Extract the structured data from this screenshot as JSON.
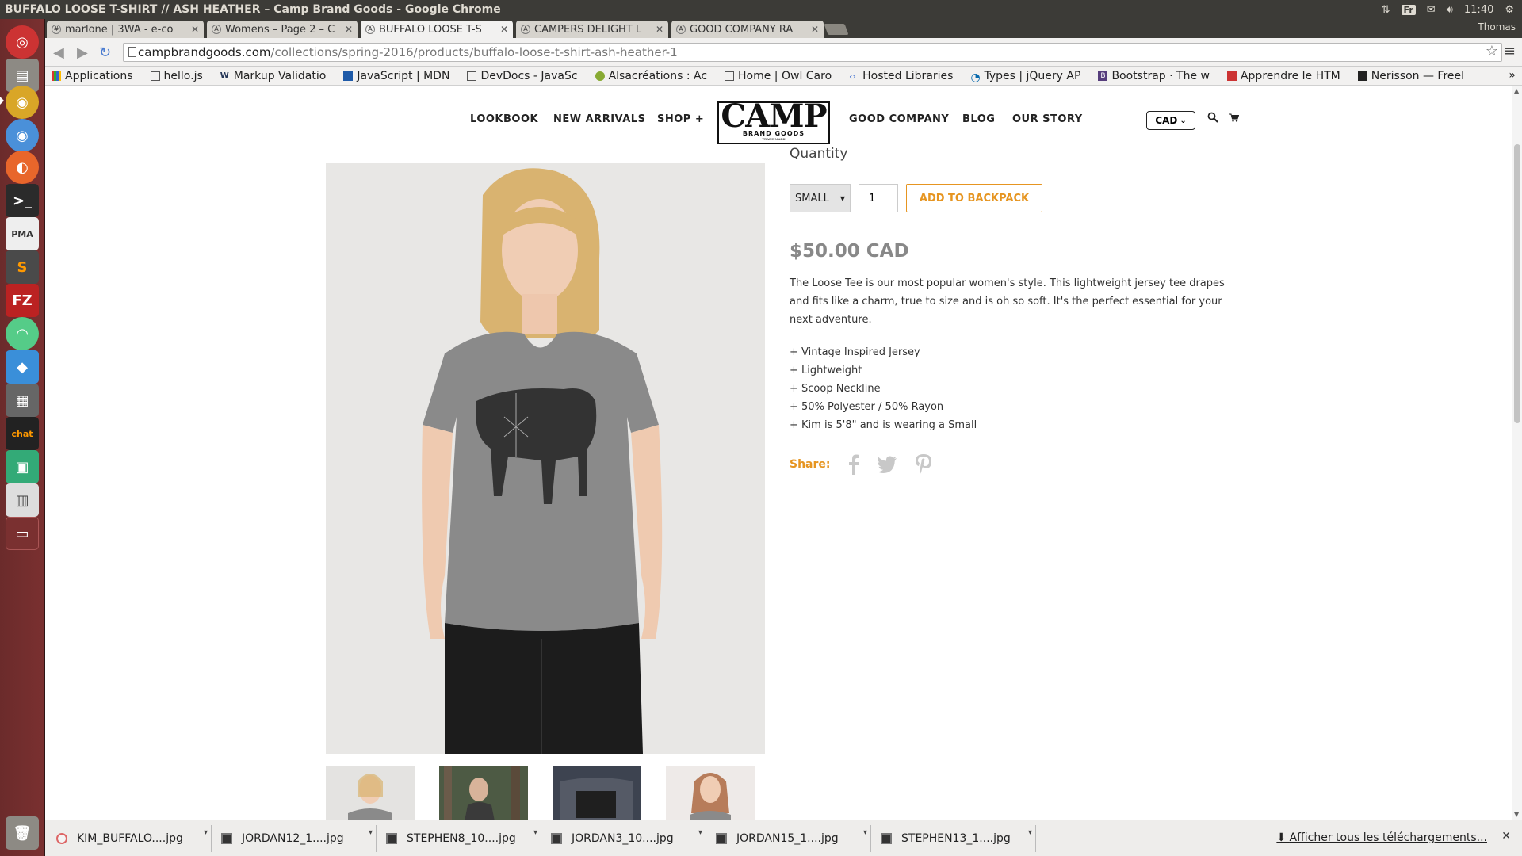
{
  "window": {
    "title": "BUFFALO LOOSE T-SHIRT // ASH HEATHER – Camp Brand Goods - Google Chrome",
    "keyboard_layout": "Fr",
    "time": "11:40",
    "user": "Thomas"
  },
  "tabs": [
    {
      "label": "marlone | 3WA - e-co"
    },
    {
      "label": "Womens – Page 2 – C"
    },
    {
      "label": "BUFFALO LOOSE T-S"
    },
    {
      "label": "CAMPERS DELIGHT L"
    },
    {
      "label": "GOOD COMPANY RA"
    }
  ],
  "address": {
    "domain": "campbrandgoods.com",
    "path": "/collections/spring-2016/products/buffalo-loose-t-shirt-ash-heather-1"
  },
  "bookmarks": [
    {
      "label": "Applications"
    },
    {
      "label": "hello.js"
    },
    {
      "label": "Markup Validatio"
    },
    {
      "label": "JavaScript | MDN"
    },
    {
      "label": "DevDocs - JavaSc"
    },
    {
      "label": "Alsacréations : Ac"
    },
    {
      "label": "Home | Owl Caro"
    },
    {
      "label": "Hosted Libraries"
    },
    {
      "label": "Types | jQuery AP"
    },
    {
      "label": "Bootstrap · The w"
    },
    {
      "label": "Apprendre le HTM"
    },
    {
      "label": "Nerisson — Freel"
    }
  ],
  "nav": {
    "lookbook": "LOOKBOOK",
    "new_arrivals": "NEW ARRIVALS",
    "shop": "SHOP +",
    "good_company": "GOOD COMPANY",
    "blog": "BLOG",
    "our_story": "OUR STORY",
    "currency": "CAD"
  },
  "logo": {
    "big": "CAMP",
    "small": "BRAND GOODS",
    "tm": "TRADE MARK"
  },
  "product": {
    "quantity_label": "Quantity",
    "size": "SMALL",
    "quantity": "1",
    "add_button": "ADD TO BACKPACK",
    "price": "$50.00 CAD",
    "description": "The Loose Tee is our most popular women's style. This lightweight jersey tee drapes and fits like a charm, true to size and is oh so soft. It's the perfect essential for your next adventure.",
    "features": [
      "+ Vintage Inspired Jersey",
      "+ Lightweight",
      "+ Scoop Neckline",
      "+ 50% Polyester / 50% Rayon",
      "+ Kim is 5'8\" and is wearing a Small"
    ],
    "share_label": "Share:"
  },
  "downloads": [
    {
      "label": "KIM_BUFFALO....jpg"
    },
    {
      "label": "JORDAN12_1....jpg"
    },
    {
      "label": "STEPHEN8_10....jpg"
    },
    {
      "label": "JORDAN3_10....jpg"
    },
    {
      "label": "JORDAN15_1....jpg"
    },
    {
      "label": "STEPHEN13_1....jpg"
    }
  ],
  "downloads_show_all": "Afficher tous les téléchargements...",
  "colors": {
    "accent": "#e69521",
    "launcher": "#7a3030",
    "panel": "#3c3b37"
  }
}
